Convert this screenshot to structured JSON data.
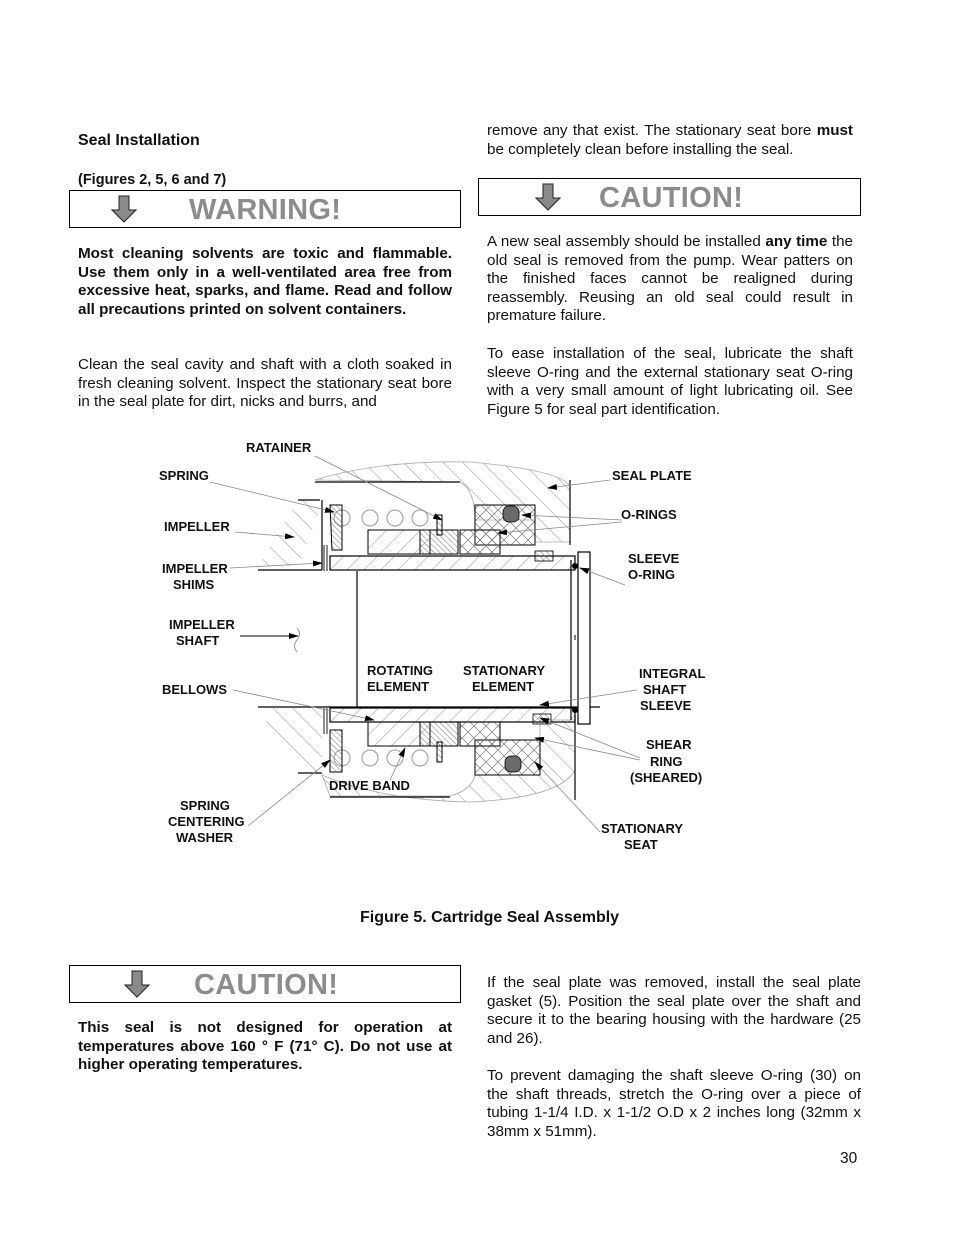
{
  "section": {
    "title": "Seal Installation",
    "figures_ref": "(Figures 2, 5, 6 and 7)"
  },
  "warning_box": {
    "icon": "down-arrow-icon",
    "label": "WARNING!"
  },
  "left_top": {
    "warning_text": "Most cleaning solvents are toxic and flammable. Use them only in a well-ventilated area free from excessive heat, sparks, and flame. Read and follow all precautions printed on solvent containers.",
    "clean_text": "Clean the seal cavity and shaft with a cloth soaked in fresh cleaning solvent. Inspect the stationary seat bore in the seal plate for dirt, nicks and burrs, and"
  },
  "right_top": {
    "cont_text_1": "remove any that exist. The stationary seat bore ",
    "cont_text_bold": "must",
    "cont_text_2": " be completely clean before installing the seal.",
    "caution_box": {
      "icon": "down-arrow-icon",
      "label": "CAUTION!"
    },
    "new_seal_1": "A new seal assembly should be installed ",
    "new_seal_bold": "any time",
    "new_seal_2": " the old seal is removed from the pump. Wear patters on the finished faces cannot be realigned during reassembly. Reusing an old seal could result in premature failure.",
    "lubricate_text": "To ease installation of the seal, lubricate the shaft sleeve O-ring and the external stationary seat O-ring with a very small amount of light lubricating oil. See Figure 5 for seal part identification."
  },
  "figure": {
    "caption": "Figure 5. Cartridge Seal Assembly",
    "labels": {
      "ratainer": "RATAINER",
      "spring": "SPRING",
      "impeller": "IMPELLER",
      "impeller_shims_1": "IMPELLER",
      "impeller_shims_2": "SHIMS",
      "impeller_shaft_1": "IMPELLER",
      "impeller_shaft_2": "SHAFT",
      "bellows": "BELLOWS",
      "rotating_1": "ROTATING",
      "rotating_2": "ELEMENT",
      "stationary_el_1": "STATIONARY",
      "stationary_el_2": "ELEMENT",
      "seal_plate": "SEAL PLATE",
      "o_rings": "O-RINGS",
      "sleeve_oring_1": "SLEEVE",
      "sleeve_oring_2": "O-RING",
      "integral_1": "INTEGRAL",
      "integral_2": "SHAFT",
      "integral_3": "SLEEVE",
      "shear_1": "SHEAR",
      "shear_2": "RING",
      "shear_3": "(SHEARED)",
      "drive_band": "DRIVE BAND",
      "spring_washer_1": "SPRING",
      "spring_washer_2": "CENTERING",
      "spring_washer_3": "WASHER",
      "stationary_seat_1": "STATIONARY",
      "stationary_seat_2": "SEAT"
    }
  },
  "bottom_left": {
    "caution_box": {
      "icon": "down-arrow-icon",
      "label": "CAUTION!"
    },
    "temp_text": "This seal is not designed for operation at temperatures above 160 ° F (71° C). Do not use at higher operating temperatures."
  },
  "bottom_right": {
    "seal_plate_text": "If the seal plate was removed, install the seal plate gasket (5). Position the seal plate over the shaft and secure it to the bearing housing with the hardware (25 and 26).",
    "oring_text": "To prevent damaging the shaft sleeve O-ring (30) on the shaft threads, stretch the O-ring over a piece of tubing 1-1/4 I.D. x 1-1/2 O.D x 2 inches long (32mm x 38mm x 51mm)."
  },
  "page_number": "30"
}
